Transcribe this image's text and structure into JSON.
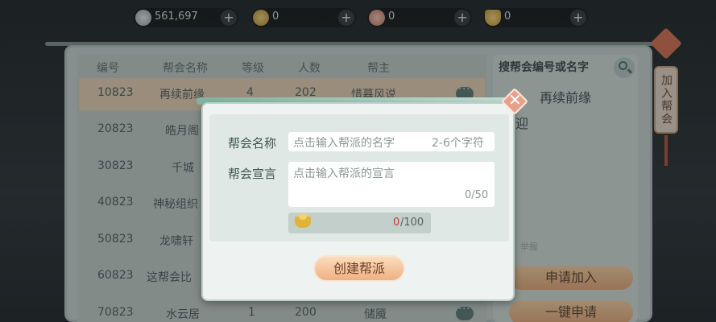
{
  "currencies": [
    {
      "icon": "silver-coin-icon",
      "value": "561,697"
    },
    {
      "icon": "gold-coin-icon",
      "value": "0"
    },
    {
      "icon": "gift-icon",
      "value": "0"
    },
    {
      "icon": "gold-ingot-icon",
      "value": "0"
    }
  ],
  "table": {
    "headers": [
      "编号",
      "帮会名称",
      "等级",
      "人数",
      "帮主"
    ],
    "rows": [
      {
        "id": "10823",
        "name": "再续前缘",
        "level": "4",
        "members": "202",
        "leader": "惜暮风说"
      },
      {
        "id": "20823",
        "name": "皓月阁",
        "level": "",
        "members": "",
        "leader": ""
      },
      {
        "id": "30823",
        "name": "千城",
        "level": "",
        "members": "",
        "leader": ""
      },
      {
        "id": "40823",
        "name": "神秘组织",
        "level": "",
        "members": "",
        "leader": ""
      },
      {
        "id": "50823",
        "name": "龙啸轩",
        "level": "",
        "members": "",
        "leader": ""
      },
      {
        "id": "60823",
        "name": "这帮会比",
        "level": "",
        "members": "",
        "leader": ""
      },
      {
        "id": "70823",
        "name": "水云居",
        "level": "1",
        "members": "200",
        "leader": "储魇"
      }
    ]
  },
  "right_panel": {
    "search_placeholder": "搜帮会编号或名字",
    "selected_name": "再续前缘",
    "selected_name_tail": "迎",
    "report": "举报",
    "apply_button": "申请加入",
    "one_click_button": "一键申请"
  },
  "side_tab": "加入帮会",
  "modal": {
    "name_label": "帮会名称",
    "name_placeholder": "点击输入帮派的名字",
    "name_hint": "2-6个字符",
    "declaration_label": "帮会宣言",
    "declaration_placeholder": "点击输入帮派的宣言",
    "declaration_count": "0/50",
    "cost_have": "0",
    "cost_need": "/100",
    "create_button": "创建帮派"
  },
  "colors": {
    "accent": "#e8a775",
    "panel": "#c8d3cf",
    "cost_red": "#c0392b"
  }
}
